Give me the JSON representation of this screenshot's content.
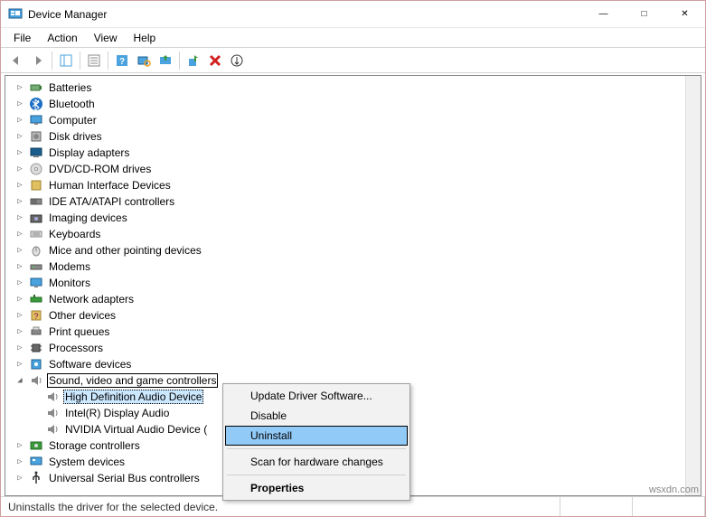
{
  "window": {
    "title": "Device Manager"
  },
  "menubar": [
    "File",
    "Action",
    "View",
    "Help"
  ],
  "tree": [
    {
      "label": "Batteries",
      "icon": "battery",
      "expanded": false
    },
    {
      "label": "Bluetooth",
      "icon": "bluetooth",
      "expanded": false
    },
    {
      "label": "Computer",
      "icon": "computer",
      "expanded": false
    },
    {
      "label": "Disk drives",
      "icon": "disk",
      "expanded": false
    },
    {
      "label": "Display adapters",
      "icon": "display",
      "expanded": false
    },
    {
      "label": "DVD/CD-ROM drives",
      "icon": "dvd",
      "expanded": false
    },
    {
      "label": "Human Interface Devices",
      "icon": "hid",
      "expanded": false
    },
    {
      "label": "IDE ATA/ATAPI controllers",
      "icon": "ide",
      "expanded": false
    },
    {
      "label": "Imaging devices",
      "icon": "imaging",
      "expanded": false
    },
    {
      "label": "Keyboards",
      "icon": "keyboard",
      "expanded": false
    },
    {
      "label": "Mice and other pointing devices",
      "icon": "mouse",
      "expanded": false
    },
    {
      "label": "Modems",
      "icon": "modem",
      "expanded": false
    },
    {
      "label": "Monitors",
      "icon": "monitor",
      "expanded": false
    },
    {
      "label": "Network adapters",
      "icon": "network",
      "expanded": false
    },
    {
      "label": "Other devices",
      "icon": "other",
      "expanded": false
    },
    {
      "label": "Print queues",
      "icon": "printer",
      "expanded": false
    },
    {
      "label": "Processors",
      "icon": "cpu",
      "expanded": false
    },
    {
      "label": "Software devices",
      "icon": "software",
      "expanded": false
    },
    {
      "label": "Sound, video and game controllers",
      "icon": "sound",
      "expanded": true,
      "bordered": true,
      "children": [
        {
          "label": "High Definition Audio Device",
          "icon": "speaker",
          "selected": true
        },
        {
          "label": "Intel(R) Display Audio",
          "icon": "speaker"
        },
        {
          "label": "NVIDIA Virtual Audio Device (",
          "icon": "speaker"
        }
      ]
    },
    {
      "label": "Storage controllers",
      "icon": "storage",
      "expanded": false
    },
    {
      "label": "System devices",
      "icon": "system",
      "expanded": false
    },
    {
      "label": "Universal Serial Bus controllers",
      "icon": "usb",
      "expanded": false
    }
  ],
  "context_menu": [
    {
      "label": "Update Driver Software..."
    },
    {
      "label": "Disable"
    },
    {
      "label": "Uninstall",
      "highlighted": true
    },
    {
      "sep": true
    },
    {
      "label": "Scan for hardware changes"
    },
    {
      "sep": true
    },
    {
      "label": "Properties",
      "bold": true
    }
  ],
  "statusbar": {
    "text": "Uninstalls the driver for the selected device."
  },
  "watermark": "wsxdn.com"
}
